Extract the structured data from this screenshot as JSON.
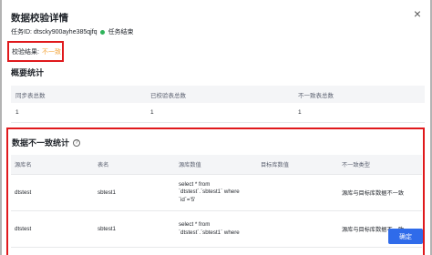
{
  "dialog": {
    "title": "数据校验详情",
    "close_icon": "close-icon",
    "task_label": "任务ID: dtscky900ayhe385qjfq",
    "task_status": "任务结束",
    "status_color": "#2fb35a",
    "verify_label": "校验结果:",
    "verify_value": "不一致",
    "verify_color": "#f3a63d",
    "confirm_label": "确定",
    "accent_color": "#2f6bea",
    "highlight_color": "#e0191c"
  },
  "summary": {
    "heading": "概要统计",
    "headers": [
      "同步表总数",
      "已校验表总数",
      "不一致表总数"
    ],
    "values": [
      "1",
      "1",
      "1"
    ]
  },
  "inconsistency": {
    "heading": "数据不一致统计",
    "help_icon": "question-circle-icon",
    "headers": [
      "源库名",
      "表名",
      "源库数值",
      "目标库数值",
      "不一致类型"
    ],
    "rows": [
      {
        "db": "dtstest",
        "table": "sbtest1",
        "source": "select * from\n`dtstest`.`sbtest1` where\n`id`='5'",
        "target": "",
        "type": "源库与目标库数据不一致"
      },
      {
        "db": "dtstest",
        "table": "sbtest1",
        "source": "select * from\n`dtstest`.`sbtest1` where",
        "target": "",
        "type": "源库与目标库数据不一致"
      }
    ]
  }
}
